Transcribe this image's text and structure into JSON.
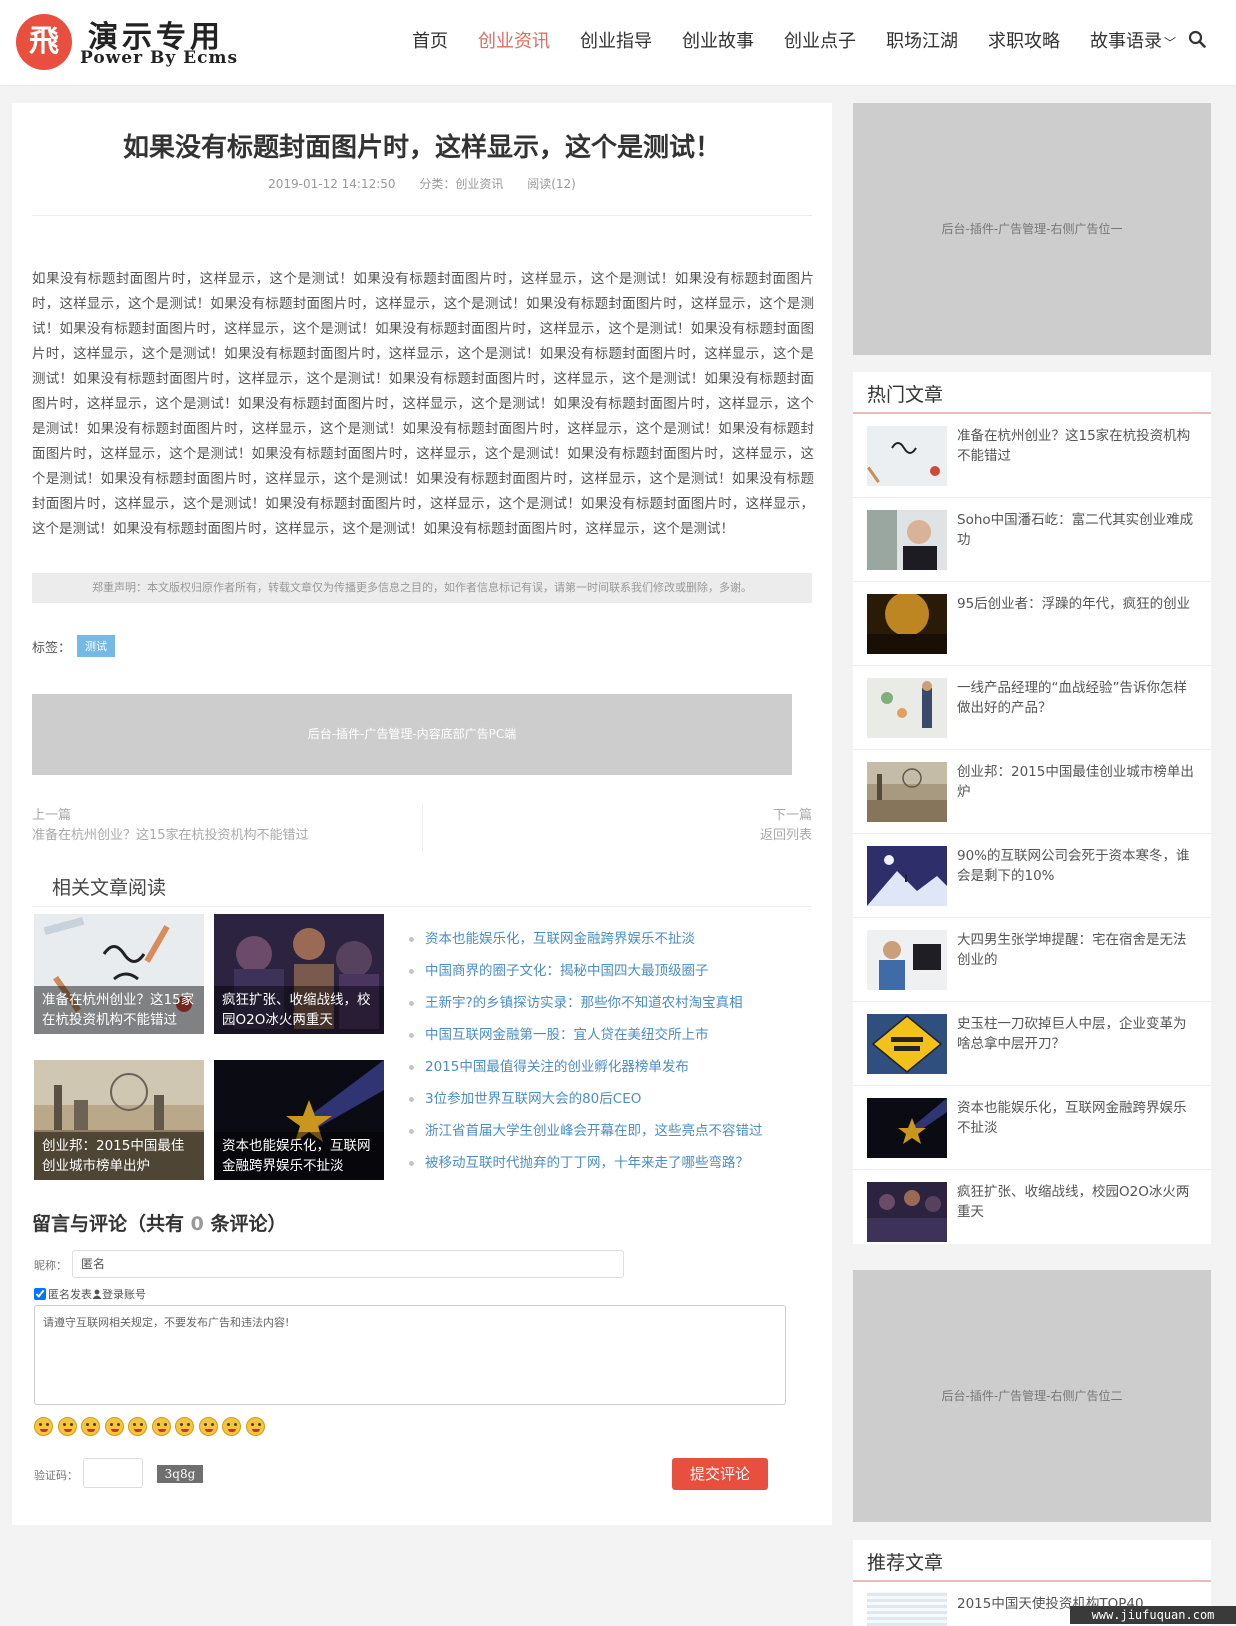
{
  "header": {
    "logo_char": "飛",
    "site_title": "演示专用",
    "site_subtitle": "Power By Ecms",
    "nav": [
      "首页",
      "创业资讯",
      "创业指导",
      "创业故事",
      "创业点子",
      "职场江湖",
      "求职攻略",
      "故事语录"
    ],
    "nav_active": "创业资讯"
  },
  "article": {
    "title": "如果没有标题封面图片时，这样显示，这个是测试！",
    "date": "2019-01-12 14:12:50",
    "category": "分类：创业资讯",
    "views": "阅读(12)",
    "body": "如果没有标题封面图片时，这样显示，这个是测试！如果没有标题封面图片时，这样显示，这个是测试！如果没有标题封面图片时，这样显示，这个是测试！如果没有标题封面图片时，这样显示，这个是测试！如果没有标题封面图片时，这样显示，这个是测试！如果没有标题封面图片时，这样显示，这个是测试！如果没有标题封面图片时，这样显示，这个是测试！如果没有标题封面图片时，这样显示，这个是测试！如果没有标题封面图片时，这样显示，这个是测试！如果没有标题封面图片时，这样显示，这个是测试！如果没有标题封面图片时，这样显示，这个是测试！如果没有标题封面图片时，这样显示，这个是测试！如果没有标题封面图片时，这样显示，这个是测试！如果没有标题封面图片时，这样显示，这个是测试！如果没有标题封面图片时，这样显示，这个是测试！如果没有标题封面图片时，这样显示，这个是测试！如果没有标题封面图片时，这样显示，这个是测试！如果没有标题封面图片时，这样显示，这个是测试！如果没有标题封面图片时，这样显示，这个是测试！如果没有标题封面图片时，这样显示，这个是测试！如果没有标题封面图片时，这样显示，这个是测试！如果没有标题封面图片时，这样显示，这个是测试！如果没有标题封面图片时，这样显示，这个是测试！如果没有标题封面图片时，这样显示，这个是测试！如果没有标题封面图片时，这样显示，这个是测试！如果没有标题封面图片时，这样显示，这个是测试！如果没有标题封面图片时，这样显示，这个是测试！",
    "disclaimer": "郑重声明：本文版权归原作者所有，转载文章仅为传播更多信息之目的，如作者信息标记有误，请第一时间联系我们修改或删除，多谢。",
    "tags_label": "标签：",
    "tag": "测试",
    "ad_bottom": "后台-插件-广告管理-内容底部广告PC端",
    "prev_label": "上一篇",
    "prev_title": "准备在杭州创业？这15家在杭投资机构不能错过",
    "next_label": "下一篇",
    "next_title": "返回列表"
  },
  "related": {
    "title": "相关文章阅读",
    "thumbs": [
      "准备在杭州创业？这15家在杭投资机构不能错过",
      "疯狂扩张、收缩战线，校园O2O冰火两重天",
      "创业邦：2015中国最佳创业城市榜单出炉",
      "资本也能娱乐化，互联网金融跨界娱乐不扯淡"
    ],
    "links": [
      "资本也能娱乐化，互联网金融跨界娱乐不扯淡",
      "中国商界的圈子文化：揭秘中国四大最顶级圈子",
      "王新宇?的乡镇探访实录：那些你不知道农村淘宝真相",
      "中国互联网金融第一股：宜人贷在美纽交所上市",
      "2015中国最值得关注的创业孵化器榜单发布",
      "3位参加世界互联网大会的80后CEO",
      "浙江省首届大学生创业峰会开幕在即，这些亮点不容错过",
      "被移动互联时代抛弃的丁丁网，十年来走了哪些弯路？"
    ]
  },
  "comments": {
    "title_prefix": "留言与评论（共有",
    "count": "0",
    "title_suffix": "条评论）",
    "nick_label": "昵称：",
    "nick_value": "匿名",
    "anon_label": "匿名发表",
    "login_label": "登录账号",
    "textarea_placeholder": "请遵守互联网相关规定，不要发布广告和违法内容!",
    "captcha_label": "验证码：",
    "captcha_text": "3q8g",
    "submit": "提交评论"
  },
  "sidebar": {
    "ad1": "后台-插件-广告管理-右侧广告位一",
    "ad2": "后台-插件-广告管理-右侧广告位二",
    "hot_title": "热门文章",
    "hot": [
      "准备在杭州创业？这15家在杭投资机构不能错过",
      "Soho中国潘石屹：富二代其实创业难成功",
      "95后创业者：浮躁的年代，疯狂的创业",
      "一线产品经理的“血战经验”告诉你怎样做出好的产品？",
      "创业邦：2015中国最佳创业城市榜单出炉",
      "90%的互联网公司会死于资本寒冬，谁会是剩下的10%",
      "大四男生张学坤提醒：宅在宿舍是无法创业的",
      "史玉柱一刀砍掉巨人中层，企业变革为啥总拿中层开刀？",
      "资本也能娱乐化，互联网金融跨界娱乐不扯淡",
      "疯狂扩张、收缩战线，校园O2O冰火两重天"
    ],
    "rec_title": "推荐文章",
    "rec_first": "2015中国天使投资机构TOP40"
  },
  "watermark": "www.jiufuquan.com",
  "colors": {
    "accent": "#e94f3e",
    "nav_active": "#e06b5e",
    "link": "#4a8ec5",
    "tag": "#75b9e6"
  }
}
